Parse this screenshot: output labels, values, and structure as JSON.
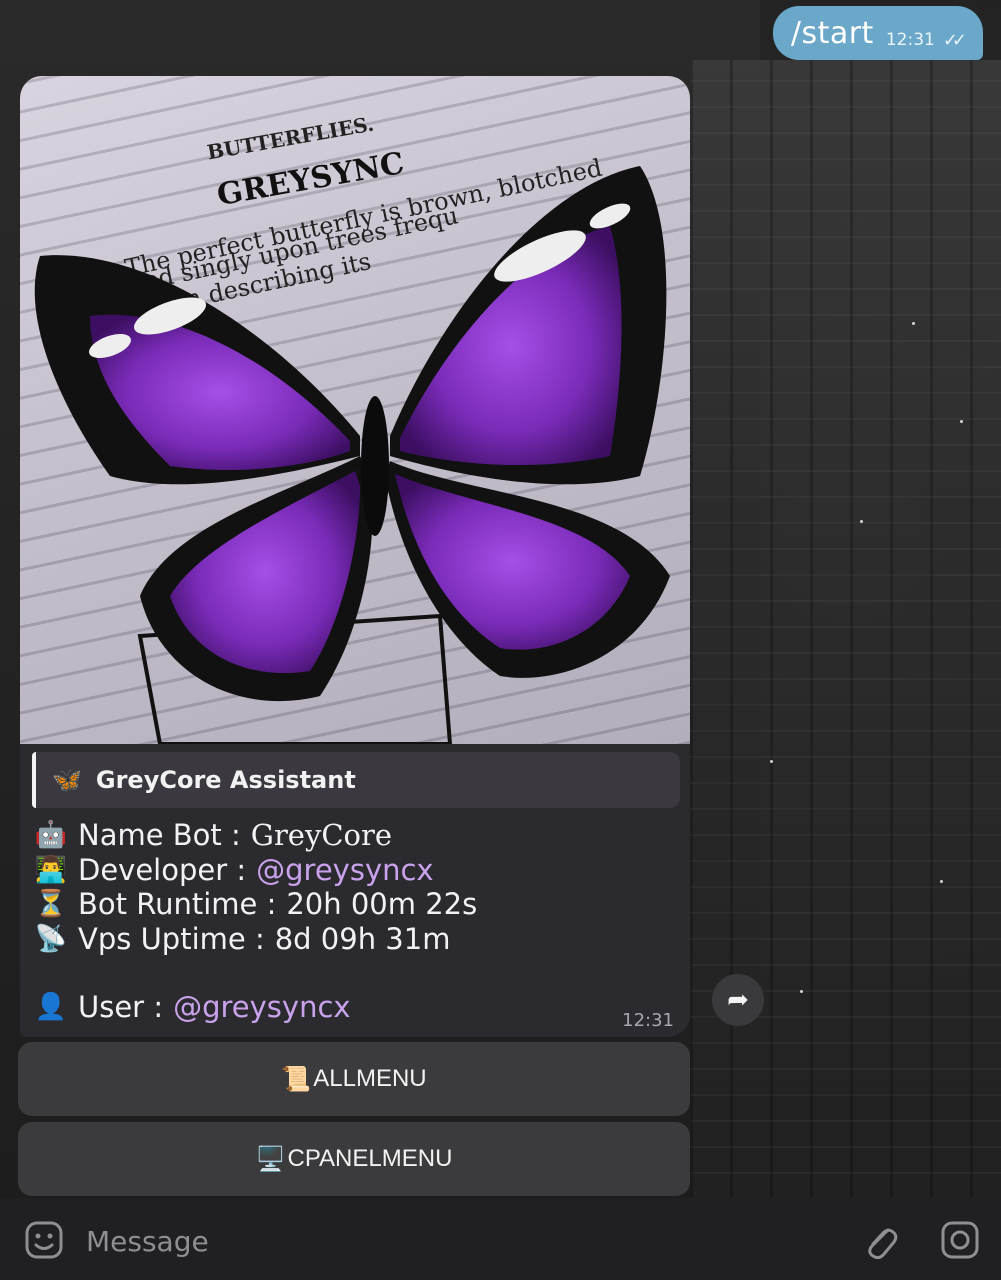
{
  "outgoing": {
    "text": "/start",
    "time": "12:31",
    "status_icon": "double-check-icon"
  },
  "incoming": {
    "photo": {
      "header_small": "BUTTERFLIES.",
      "header_large": "GREYSYNC",
      "text_lines": [
        "The perfect butterfly is brown, blotched",
        "ited singly upon trees frequ",
        "ted in describing its"
      ]
    },
    "quote_icon": "🦋",
    "quote_title": "GreyCore  Assistant",
    "rows": [
      {
        "icon": "🤖",
        "label": "Name Bot : ",
        "value": "GreyCore"
      },
      {
        "icon": "👨‍💻",
        "label": "Developer : ",
        "value": "@greysyncx"
      },
      {
        "icon": "⏳",
        "label": "Bot Runtime : ",
        "value": "20h 00m 22s"
      },
      {
        "icon": "📡",
        "label": "Vps Uptime : ",
        "value": "8d 09h 31m"
      },
      {
        "icon": "👤",
        "label": "User : ",
        "value": "@greysyncx"
      }
    ],
    "time": "12:31"
  },
  "buttons": [
    {
      "icon": "📜",
      "label": "ALLMENU"
    },
    {
      "icon": "🖥️",
      "label": "CPANELMENU"
    }
  ],
  "composer": {
    "placeholder": "Message",
    "icons": [
      "emoji-icon",
      "attach-icon",
      "camera-icon"
    ]
  },
  "colors": {
    "outgoing_bubble": "#6aa7c9",
    "incoming_bubble": "#2b2a2f",
    "link": "#c9a2ec",
    "butterfly": "#7a2bb8"
  }
}
